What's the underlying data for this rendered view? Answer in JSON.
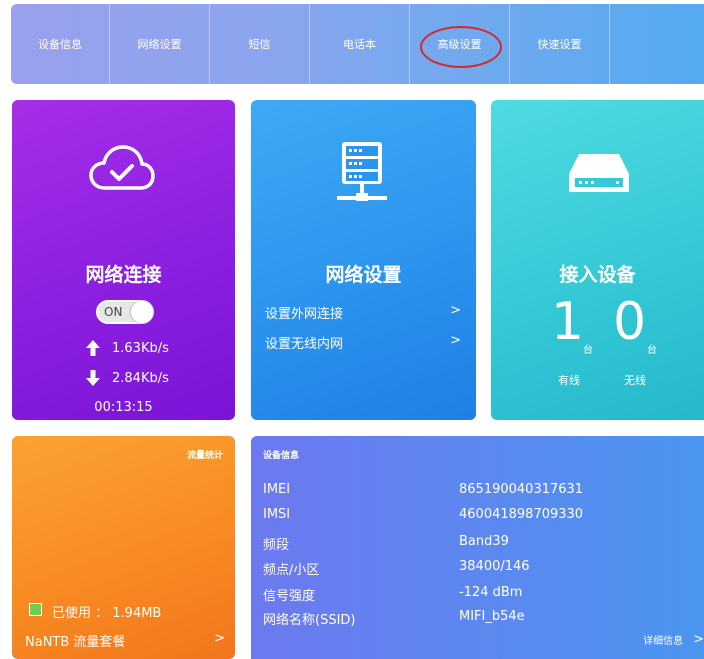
{
  "nav": {
    "items": [
      "设备信息",
      "网络设置",
      "短信",
      "电话本",
      "高级设置",
      "快速设置"
    ],
    "highlighted_item": "高级设置",
    "highlight_color": "#d42a2a"
  },
  "network_card": {
    "title": "网络连接",
    "toggle_label": "ON",
    "upload_speed": "1.63Kb/s",
    "download_speed": "2.84Kb/s",
    "duration": "00:13:15",
    "icon": "cloud-check-icon",
    "color": "#8c1fe0"
  },
  "settings_card": {
    "title": "网络设置",
    "links": [
      {
        "label": "设置外网连接",
        "chevron": ">"
      },
      {
        "label": "设置无线内网",
        "chevron": ">"
      }
    ],
    "icon": "server-icon",
    "color": "#2b94ee"
  },
  "devices_card": {
    "title": "接入设备",
    "wired_count": "1",
    "wireless_count": "0",
    "unit": "台",
    "wired_label": "有线",
    "wireless_label": "无线",
    "icon": "router-icon",
    "color": "#35c9d6"
  },
  "traffic_card": {
    "title": "流量统计",
    "used_text": "已使用 ： 1.94MB",
    "plan_label": "NaNTB 流量套餐",
    "chevron": ">",
    "color": "#f88b22",
    "legend_color": "#6ed14d"
  },
  "info_card": {
    "title": "设备信息",
    "rows": [
      {
        "label": "IMEI",
        "value": "865190040317631"
      },
      {
        "label": "IMSI",
        "value": "460041898709330"
      },
      {
        "label": "频段",
        "value": "Band39"
      },
      {
        "label": "频点/小区",
        "value": "38400/146"
      },
      {
        "label": "信号强度",
        "value": "-124 dBm"
      },
      {
        "label": "网络名称(SSID)",
        "value": "MIFI_b54e"
      }
    ],
    "detail_link": "详细信息",
    "chevron": ">",
    "color": "#5d87f0"
  }
}
